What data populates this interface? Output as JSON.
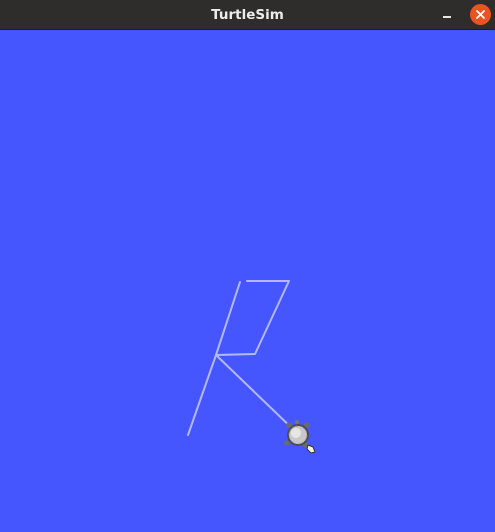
{
  "window": {
    "title": "TurtleSim"
  },
  "titlebar": {
    "minimize_icon": "minimize-icon",
    "close_icon": "close-icon",
    "close_color": "#e95420",
    "bar_color": "#2e2d2b"
  },
  "canvas": {
    "background_color": "#4556ff",
    "pen_color": "#b3b8ff",
    "turtle_icon": "turtle-icon"
  }
}
